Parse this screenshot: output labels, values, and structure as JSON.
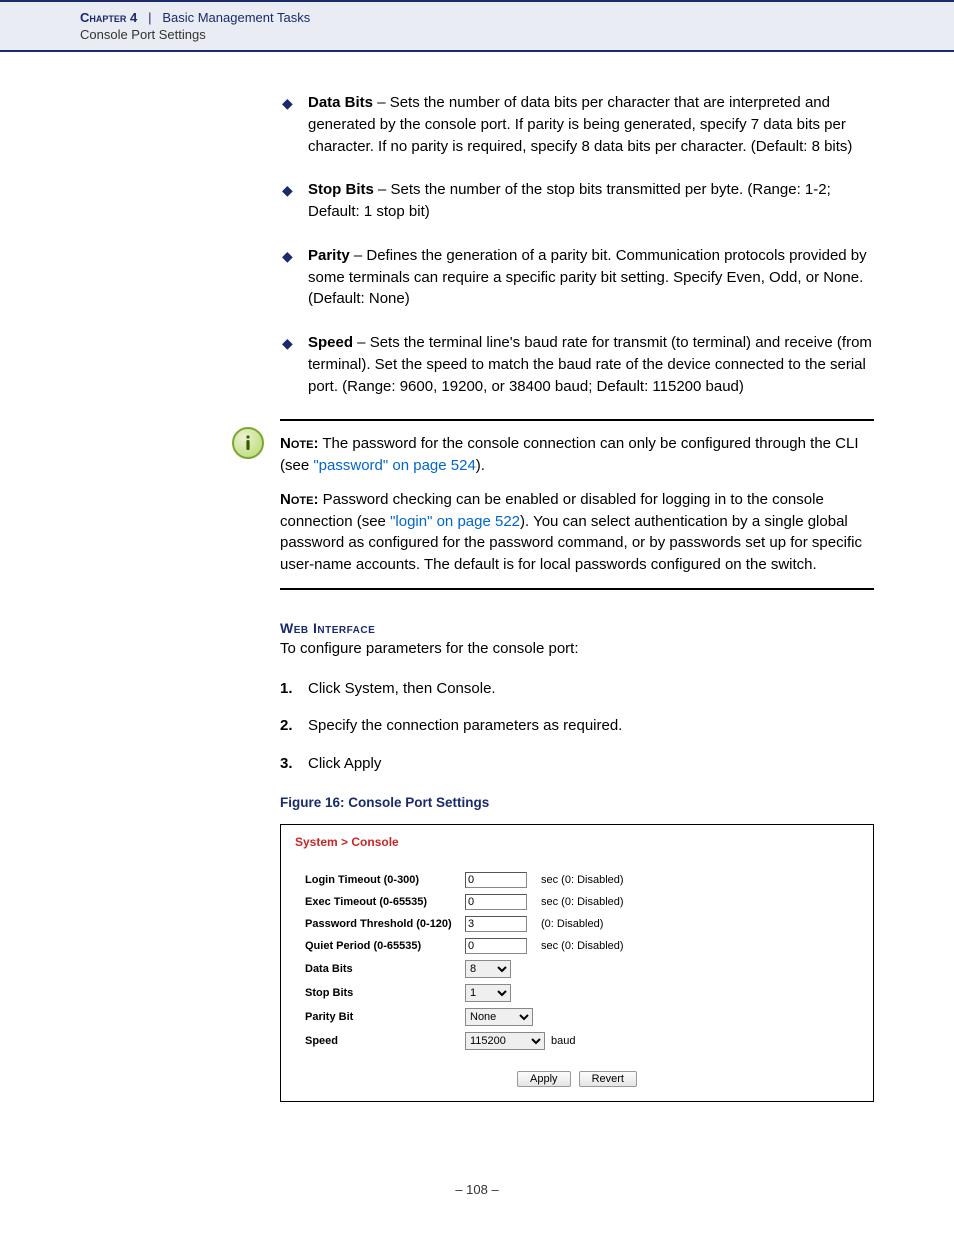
{
  "header": {
    "chapter": "Chapter 4",
    "separator": "|",
    "section": "Basic Management Tasks",
    "subsection": "Console Port Settings"
  },
  "bullets": [
    {
      "term": "Data Bits",
      "text": " – Sets the number of data bits per character that are interpreted and generated by the console port. If parity is being generated, specify 7 data bits per character. If no parity is required, specify 8 data bits per character. (Default: 8 bits)"
    },
    {
      "term": "Stop Bits",
      "text": " – Sets the number of the stop bits transmitted per byte. (Range: 1-2; Default: 1 stop bit)"
    },
    {
      "term": "Parity",
      "text": " – Defines the generation of a parity bit. Communication protocols provided by some terminals can require a specific parity bit setting. Specify Even, Odd, or None. (Default: None)"
    },
    {
      "term": "Speed",
      "text": " – Sets the terminal line's baud rate for transmit (to terminal) and receive (from terminal). Set the speed to match the baud rate of the device connected to the serial port. (Range: 9600, 19200, or 38400 baud; Default: 115200 baud)"
    }
  ],
  "notes": {
    "label1": "Note:",
    "n1_pre": " The password for the console connection can only be configured through the CLI (see ",
    "n1_link": "\"password\" on page 524",
    "n1_post": ").",
    "label2": "Note:",
    "n2_pre": " Password checking can be enabled or disabled for logging in to the console connection (see ",
    "n2_link": "\"login\" on page 522",
    "n2_post": "). You can select authentication by a single global password as configured for the password command, or by passwords set up for specific user-name accounts. The default is for local passwords configured on the switch."
  },
  "web": {
    "heading": "Web Interface",
    "intro": "To configure parameters for the console port:",
    "steps": [
      "Click System, then Console.",
      "Specify the connection parameters as required.",
      "Click Apply"
    ]
  },
  "figure_caption": "Figure 16:  Console Port Settings",
  "panel": {
    "breadcrumb": "System > Console",
    "rows": {
      "login_timeout": {
        "label": "Login Timeout (0-300)",
        "value": "0",
        "hint": "sec (0: Disabled)"
      },
      "exec_timeout": {
        "label": "Exec Timeout (0-65535)",
        "value": "0",
        "hint": "sec (0: Disabled)"
      },
      "password_threshold": {
        "label": "Password Threshold (0-120)",
        "value": "3",
        "hint": "(0: Disabled)"
      },
      "quiet_period": {
        "label": "Quiet Period (0-65535)",
        "value": "0",
        "hint": "sec (0: Disabled)"
      },
      "data_bits": {
        "label": "Data Bits",
        "value": "8"
      },
      "stop_bits": {
        "label": "Stop Bits",
        "value": "1"
      },
      "parity_bit": {
        "label": "Parity Bit",
        "value": "None"
      },
      "speed": {
        "label": "Speed",
        "value": "115200",
        "hint": "baud"
      }
    },
    "buttons": {
      "apply": "Apply",
      "revert": "Revert"
    }
  },
  "page_number": "–  108  –"
}
